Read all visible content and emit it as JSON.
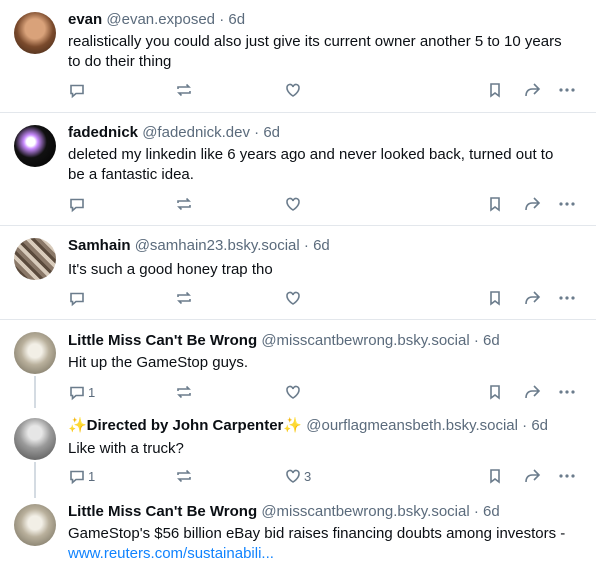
{
  "posts": [
    {
      "name": "evan",
      "handle": "@evan.exposed",
      "age": "6d",
      "text": "realistically you could also just give its current owner another 5 to 10 years to do their thing",
      "replies": "",
      "likes": ""
    },
    {
      "name": "fadednick",
      "handle": "@fadednick.dev",
      "age": "6d",
      "text": "deleted my linkedin like 6 years ago and never looked back, turned out to be a fantastic idea.",
      "replies": "",
      "likes": ""
    },
    {
      "name": "Samhain",
      "handle": "@samhain23.bsky.social",
      "age": "6d",
      "text": "It's such a good honey trap tho",
      "replies": "",
      "likes": ""
    },
    {
      "name": "Little Miss Can't Be Wrong",
      "handle": "@misscantbewrong.bsky.social",
      "age": "6d",
      "text": "Hit up the GameStop guys.",
      "replies": "1",
      "likes": ""
    },
    {
      "name": "✨Directed by John Carpenter✨",
      "handle": "@ourflagmeansbeth.bsky.social",
      "age": "6d",
      "text": "Like with a truck?",
      "replies": "1",
      "likes": "3"
    },
    {
      "name": "Little Miss Can't Be Wrong",
      "handle": "@misscantbewrong.bsky.social",
      "age": "6d",
      "text": "GameStop's $56 billion eBay bid raises financing doubts among investors - ",
      "link": "www.reuters.com/sustainabili..."
    }
  ],
  "separator": "·",
  "icons": {
    "reply": "reply-icon",
    "repost": "repost-icon",
    "like": "heart-icon",
    "bookmark": "bookmark-icon",
    "share": "share-icon",
    "more": "more-icon"
  },
  "colors": {
    "link": "#1083fe",
    "muted": "#5b6b7c",
    "text": "#0b0f14"
  }
}
